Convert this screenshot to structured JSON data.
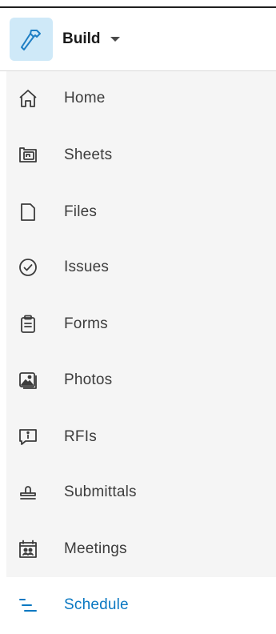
{
  "app": {
    "name": "Build",
    "icon": "hammer-icon",
    "accent": "#0a78c2",
    "tile_color": "#cfe9f8"
  },
  "nav": {
    "items": [
      {
        "label": "Home",
        "icon": "home-icon"
      },
      {
        "label": "Sheets",
        "icon": "sheets-icon"
      },
      {
        "label": "Files",
        "icon": "file-icon"
      },
      {
        "label": "Issues",
        "icon": "check-circle-icon"
      },
      {
        "label": "Forms",
        "icon": "clipboard-icon"
      },
      {
        "label": "Photos",
        "icon": "photo-icon"
      },
      {
        "label": "RFIs",
        "icon": "info-bubble-icon"
      },
      {
        "label": "Submittals",
        "icon": "stamp-icon"
      },
      {
        "label": "Meetings",
        "icon": "calendar-people-icon"
      },
      {
        "label": "Schedule",
        "icon": "schedule-icon",
        "active": true
      }
    ]
  }
}
